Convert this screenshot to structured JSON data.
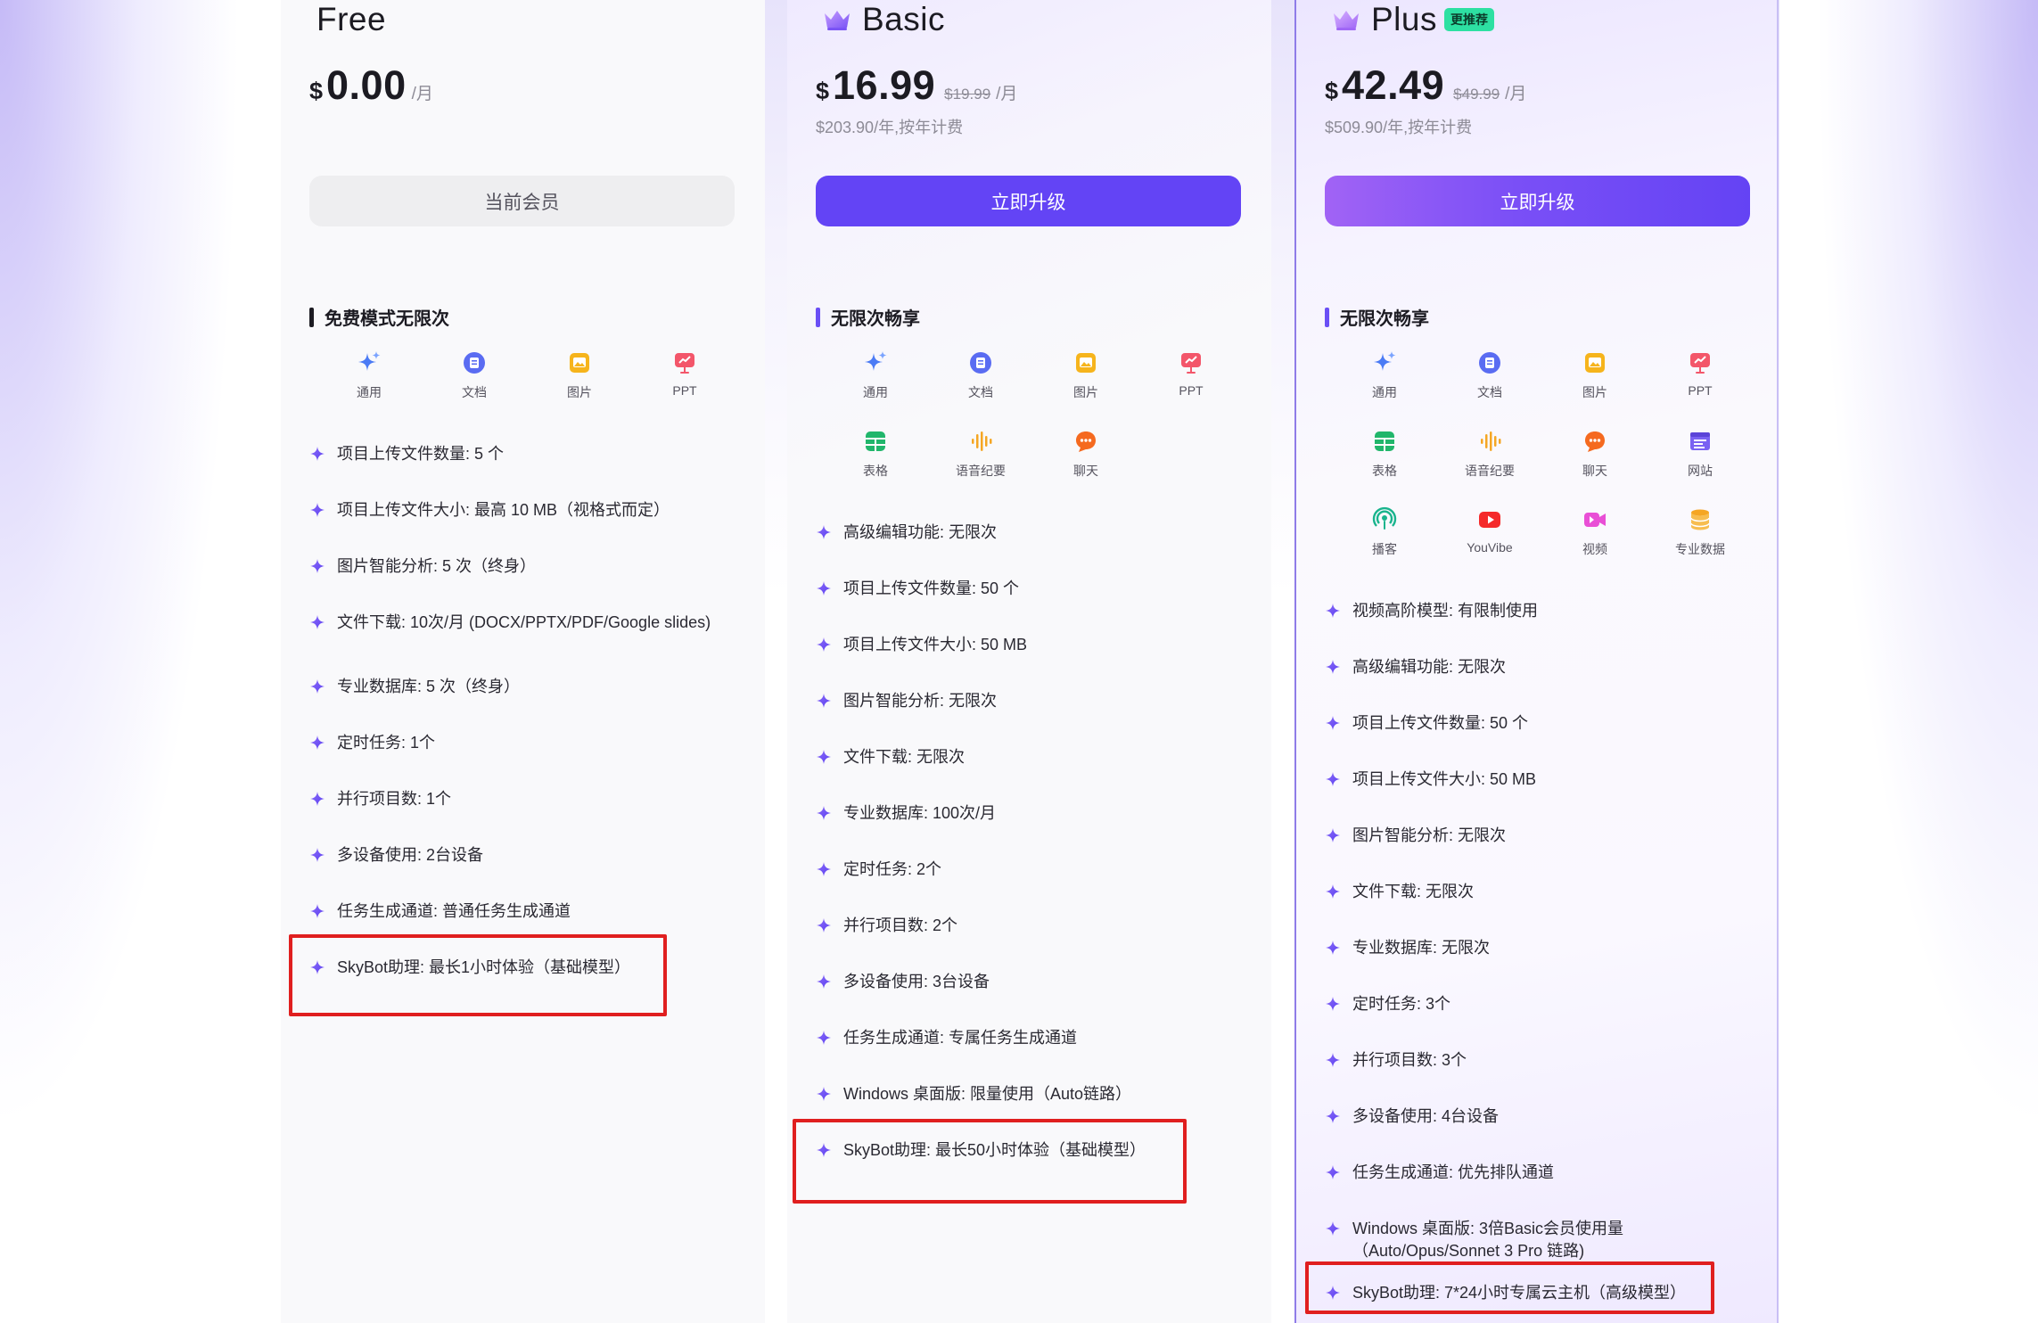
{
  "plans": {
    "free": {
      "name": "Free",
      "currency": "$",
      "price": "0.00",
      "period": "/月",
      "cta": "当前会员",
      "section_title": "免费模式无限次",
      "icons": [
        {
          "label": "通用",
          "icon": "sparkle-icon"
        },
        {
          "label": "文档",
          "icon": "document-icon"
        },
        {
          "label": "图片",
          "icon": "image-icon"
        },
        {
          "label": "PPT",
          "icon": "presentation-icon"
        }
      ],
      "features": [
        "项目上传文件数量: 5 个",
        "项目上传文件大小: 最高 10 MB（视格式而定）",
        "图片智能分析: 5 次（终身）",
        "文件下载: 10次/月 (DOCX/PPTX/PDF/Google slides)",
        "专业数据库: 5 次（终身）",
        "定时任务: 1个",
        "并行项目数: 1个",
        "多设备使用: 2台设备",
        "任务生成通道: 普通任务生成通道",
        "SkyBot助理: 最长1小时体验（基础模型）"
      ]
    },
    "basic": {
      "name": "Basic",
      "currency": "$",
      "price": "16.99",
      "old_price": "$19.99",
      "period": "/月",
      "annual": "$203.90/年,按年计费",
      "cta": "立即升级",
      "section_title": "无限次畅享",
      "icons": [
        {
          "label": "通用",
          "icon": "sparkle-icon"
        },
        {
          "label": "文档",
          "icon": "document-icon"
        },
        {
          "label": "图片",
          "icon": "image-icon"
        },
        {
          "label": "PPT",
          "icon": "presentation-icon"
        },
        {
          "label": "表格",
          "icon": "table-icon"
        },
        {
          "label": "语音纪要",
          "icon": "audio-wave-icon"
        },
        {
          "label": "聊天",
          "icon": "chat-icon"
        }
      ],
      "features": [
        "高级编辑功能: 无限次",
        "项目上传文件数量: 50 个",
        "项目上传文件大小: 50 MB",
        "图片智能分析: 无限次",
        "文件下载: 无限次",
        "专业数据库: 100次/月",
        "定时任务: 2个",
        "并行项目数: 2个",
        "多设备使用: 3台设备",
        "任务生成通道: 专属任务生成通道",
        "Windows 桌面版: 限量使用（Auto链路）",
        "SkyBot助理: 最长50小时体验（基础模型）"
      ]
    },
    "plus": {
      "name": "Plus",
      "badge": "更推荐",
      "currency": "$",
      "price": "42.49",
      "old_price": "$49.99",
      "period": "/月",
      "annual": "$509.90/年,按年计费",
      "cta": "立即升级",
      "section_title": "无限次畅享",
      "icons": [
        {
          "label": "通用",
          "icon": "sparkle-icon"
        },
        {
          "label": "文档",
          "icon": "document-icon"
        },
        {
          "label": "图片",
          "icon": "image-icon"
        },
        {
          "label": "PPT",
          "icon": "presentation-icon"
        },
        {
          "label": "表格",
          "icon": "table-icon"
        },
        {
          "label": "语音纪要",
          "icon": "audio-wave-icon"
        },
        {
          "label": "聊天",
          "icon": "chat-icon"
        },
        {
          "label": "网站",
          "icon": "website-icon"
        },
        {
          "label": "播客",
          "icon": "podcast-icon"
        },
        {
          "label": "YouVibe",
          "icon": "play-icon"
        },
        {
          "label": "视频",
          "icon": "video-icon"
        },
        {
          "label": "专业数据",
          "icon": "database-icon"
        }
      ],
      "features": [
        "视频高阶模型: 有限制使用",
        "高级编辑功能: 无限次",
        "项目上传文件数量: 50 个",
        "项目上传文件大小: 50 MB",
        "图片智能分析: 无限次",
        "文件下载: 无限次",
        "专业数据库: 无限次",
        "定时任务: 3个",
        "并行项目数: 3个",
        "多设备使用: 4台设备",
        "任务生成通道: 优先排队通道",
        "Windows 桌面版: 3倍Basic会员使用量（Auto/Opus/Sonnet 3 Pro 链路)",
        "SkyBot助理: 7*24小时专属云主机（高级模型）"
      ]
    }
  },
  "colors": {
    "primary": "#6344f5",
    "highlight_box": "#e01f1f",
    "badge": "#2de0a2"
  }
}
